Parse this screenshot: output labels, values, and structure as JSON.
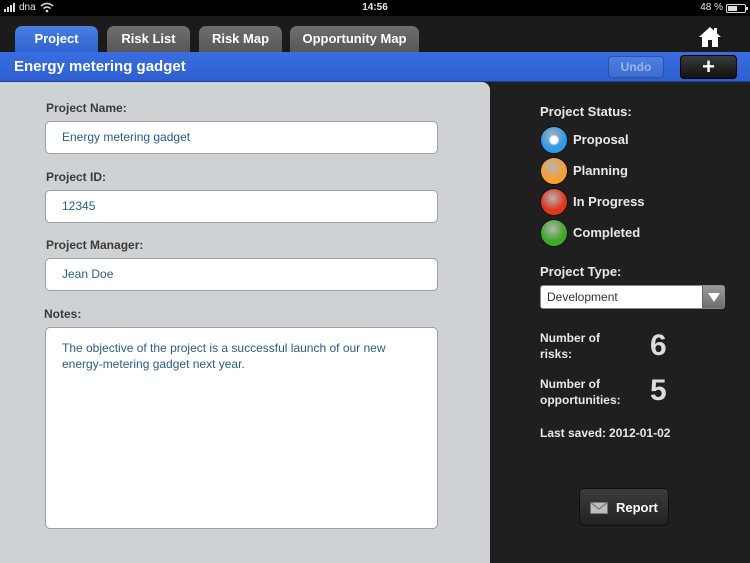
{
  "statusbar": {
    "carrier": "dna",
    "time": "14:56",
    "battery": "48 %",
    "battery_level": 0.48
  },
  "tabs": [
    "Project",
    "Risk List",
    "Risk Map",
    "Opportunity Map"
  ],
  "titlebar": {
    "title": "Energy metering gadget",
    "undo": "Undo",
    "add": "+"
  },
  "form": {
    "name_label": "Project Name:",
    "name_value": "Energy metering gadget",
    "id_label": "Project ID:",
    "id_value": "12345",
    "manager_label": "Project Manager:",
    "manager_value": "Jean Doe",
    "notes_label": "Notes:",
    "notes_value": "The objective of the project is a successful launch of our new energy-metering gadget next year."
  },
  "side": {
    "status_label": "Project Status:",
    "statuses": [
      {
        "label": "Proposal",
        "color": "#2e9be8",
        "selected": true
      },
      {
        "label": "Planning",
        "color": "#f5a030",
        "selected": false
      },
      {
        "label": "In Progress",
        "color": "#e0361e",
        "selected": false
      },
      {
        "label": "Completed",
        "color": "#3ea82a",
        "selected": false
      }
    ],
    "type_label": "Project Type:",
    "type_value": "Development",
    "risks_label_1": "Number of",
    "risks_label_2": "risks:",
    "risks_value": "6",
    "opps_label_1": "Number of",
    "opps_label_2": "opportunities:",
    "opps_value": "5",
    "saved_label": "Last saved:",
    "saved_value": "2012-01-02",
    "report": "Report"
  }
}
